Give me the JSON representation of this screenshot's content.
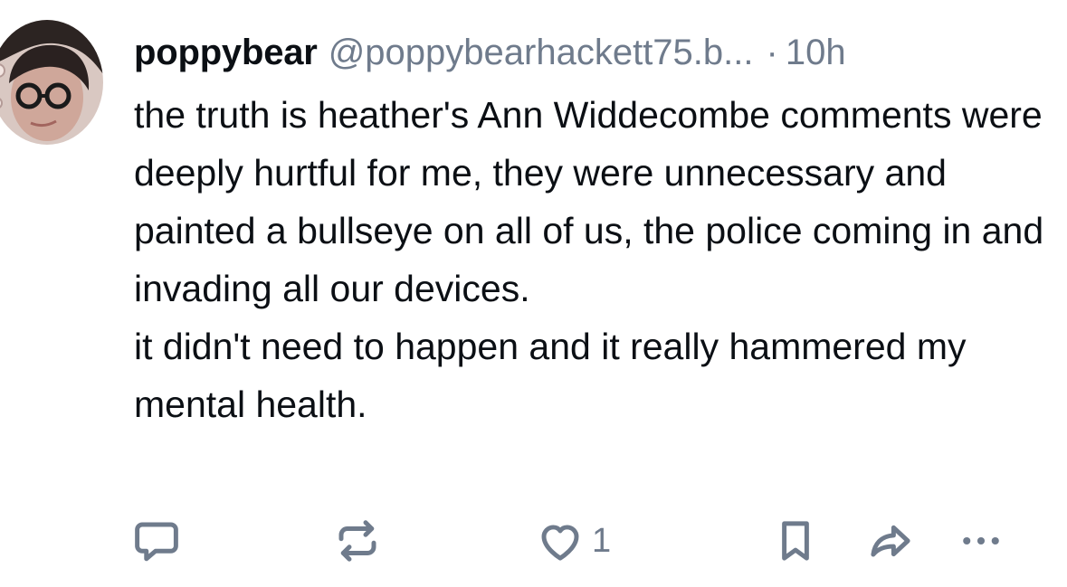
{
  "post": {
    "author": {
      "display_name": "poppybear",
      "handle": "@poppybearhackett75.b...",
      "avatar_icon": "user-avatar"
    },
    "separator": "·",
    "timestamp": "10h",
    "text_paragraphs": [
      "the truth is heather's Ann Widdecombe comments were deeply hurtful for me, they were unnecessary and painted a bullseye on all of us, the police coming in and invading all our devices.",
      "it didn't need to happen and it really hammered my mental health."
    ],
    "actions": {
      "reply_icon": "reply-icon",
      "repost_icon": "repost-icon",
      "like_icon": "heart-icon",
      "like_count": "1",
      "bookmark_icon": "bookmark-icon",
      "share_icon": "share-icon",
      "more_icon": "more-icon"
    }
  },
  "colors": {
    "text": "#0b0f14",
    "muted": "#6f7b8c",
    "icon": "#6f7b8c",
    "background": "#ffffff"
  }
}
